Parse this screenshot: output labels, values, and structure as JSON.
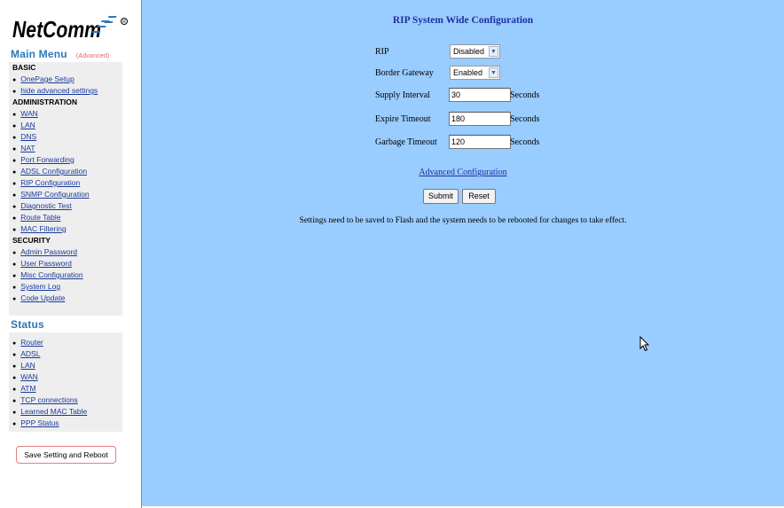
{
  "logo": {
    "text": "NetComm"
  },
  "main_menu": {
    "title": "Main Menu",
    "mode": "(Advanced)"
  },
  "menu_sections": [
    {
      "heading": "BASIC",
      "items": [
        "OnePage Setup",
        "hide advanced settings"
      ]
    },
    {
      "heading": "ADMINISTRATION",
      "items": [
        "WAN",
        "LAN",
        "DNS",
        "NAT",
        "Port Forwarding",
        "ADSL Configuration",
        "RIP Configuration",
        "SNMP Configuration",
        "Diagnostic Test",
        "Route Table",
        "MAC Filtering"
      ]
    },
    {
      "heading": "SECURITY",
      "items": [
        "Admin Password",
        "User Password",
        "Misc Configuration",
        "System Log",
        "Code Update"
      ]
    }
  ],
  "status_menu": {
    "title": "Status",
    "items": [
      "Router",
      "ADSL",
      "LAN",
      "WAN",
      "ATM",
      "TCP connections",
      "Learned MAC Table",
      "PPP Status"
    ]
  },
  "save_reboot_label": "Save Setting and Reboot",
  "page": {
    "title": "RIP System Wide Configuration",
    "rip": {
      "label": "RIP",
      "value": "Disabled"
    },
    "border_gateway": {
      "label": "Border Gateway",
      "value": "Enabled"
    },
    "supply_interval": {
      "label": "Supply Interval",
      "value": "30",
      "unit": "Seconds"
    },
    "expire_timeout": {
      "label": "Expire Timeout",
      "value": "180",
      "unit": "Seconds"
    },
    "garbage_timeout": {
      "label": "Garbage Timeout",
      "value": "120",
      "unit": "Seconds"
    },
    "advanced_link": "Advanced Configuration",
    "submit_label": "Submit",
    "reset_label": "Reset",
    "note": "Settings need to be saved to Flash and the system needs to be rebooted for changes to take effect."
  },
  "colors": {
    "main_bg": "#99ccff",
    "title": "#1f2fa0",
    "menu_title": "#2b78b8",
    "panel_bg": "#eeeeee"
  }
}
